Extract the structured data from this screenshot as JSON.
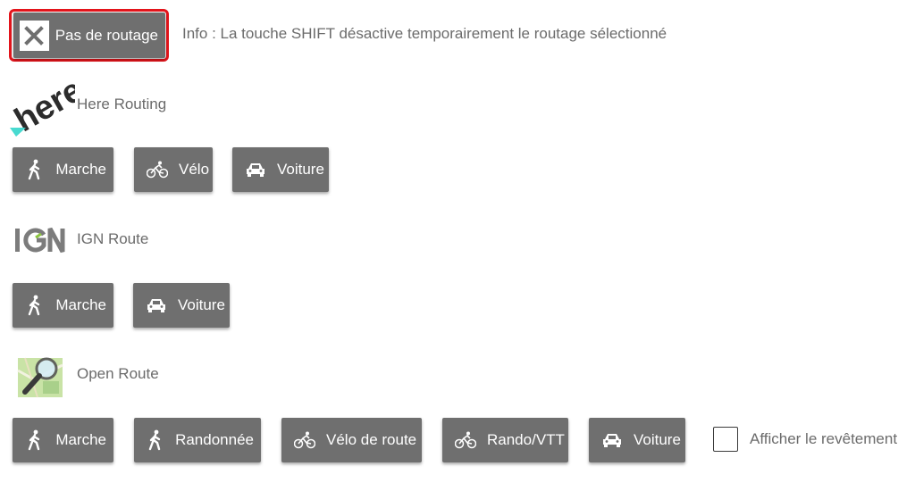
{
  "top": {
    "no_routing_label": "Pas de routage",
    "info_text": "Info : La touche SHIFT désactive temporairement le routage sélectionné"
  },
  "providers": {
    "here": {
      "logo_text": "here",
      "label": "Here Routing",
      "buttons": [
        "Marche",
        "Vélo",
        "Voiture"
      ]
    },
    "ign": {
      "logo_text": "IGN",
      "label": "IGN Route",
      "buttons": [
        "Marche",
        "Voiture"
      ]
    },
    "openroute": {
      "label": "Open Route",
      "buttons": [
        "Marche",
        "Randonnée",
        "Vélo de route",
        "Rando/VTT",
        "Voiture"
      ]
    }
  },
  "surface_option": {
    "label": "Afficher le revêtement",
    "checked": false
  },
  "colors": {
    "button_bg": "#6f6f6f",
    "selected_outline": "#e3141b",
    "text_muted": "#6b6b6b",
    "here_teal": "#48dad0",
    "ign_green": "#8cc63f"
  },
  "icons": {
    "no_routing": "close-icon",
    "walk": "pedestrian-icon",
    "bike": "bicycle-icon",
    "car": "car-icon"
  }
}
